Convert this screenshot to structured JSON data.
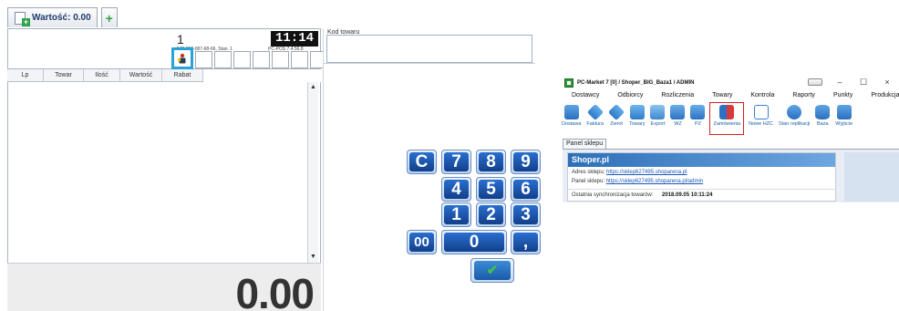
{
  "pos": {
    "tab_label": "Wartość: 0.00",
    "tab_add": "+",
    "receipt_number": "1",
    "info_line": "NIP 626-087-68-66, Stan. 1",
    "version": "PC-POS 7.4.56.8",
    "clock": "11:14",
    "table_headers": [
      "Lp",
      "Towar",
      "Ilość",
      "Wartość",
      "Rabat"
    ],
    "scroll_up": "▲",
    "scroll_down": "▼",
    "total": "0.00",
    "code_label": "Kod towaru",
    "keys": {
      "clear": "C",
      "seven": "7",
      "eight": "8",
      "nine": "9",
      "four": "4",
      "five": "5",
      "six": "6",
      "one": "1",
      "two": "2",
      "three": "3",
      "double_zero": "00",
      "zero": "0",
      "comma": ",",
      "ok": "✔"
    }
  },
  "pcm": {
    "title": "PC-Market 7 [0] / Shoper_BIG_Baza1 / ADMIN",
    "window_buttons": {
      "minimize": "–",
      "maximize": "☐",
      "close": "×"
    },
    "menu": [
      "Dostawcy",
      "Odbiorcy",
      "Rozliczenia",
      "Towary",
      "Kontrola",
      "Raporty",
      "Punkty",
      "Produkcja"
    ],
    "toolbar": [
      {
        "label": "Dostawa",
        "icon": "truck-icon"
      },
      {
        "label": "Faktura",
        "icon": "tag-icon"
      },
      {
        "label": "Zwrot",
        "icon": "return-tag-icon"
      },
      {
        "label": "Towary",
        "icon": "products-icon"
      },
      {
        "label": "Export",
        "icon": "export-icon"
      },
      {
        "label": "WZ",
        "icon": "wz-document-icon"
      },
      {
        "label": "PZ",
        "icon": "pz-document-icon"
      },
      {
        "label": "Zamówienia",
        "icon": "orders-icon"
      },
      {
        "label": "Nowe HZC",
        "icon": "new-hzc-icon"
      },
      {
        "label": "Stan replikacji",
        "icon": "replication-icon"
      },
      {
        "label": "Baza",
        "icon": "database-icon"
      },
      {
        "label": "Wyjście",
        "icon": "exit-icon"
      }
    ],
    "panel_tab": "Panel sklepu",
    "shoper": {
      "name": "Shoper.pl",
      "address_label": "Adres sklepu:",
      "address_url": "https://sklep627495.shoparena.pl",
      "panel_label": "Panel sklepu:",
      "panel_url": "https://sklep627495.shoparena.pl/admin",
      "sync_label": "Ostatnia synchronizacja towarów:",
      "sync_value": "2018.09.05 10:11:24"
    }
  },
  "colors": {
    "key_blue": "#1f5cb8",
    "highlight_cyan": "#2aa1d8",
    "highlight_red": "#d42121",
    "shoper_header": "#2d6fb8",
    "link": "#1a55b8"
  }
}
